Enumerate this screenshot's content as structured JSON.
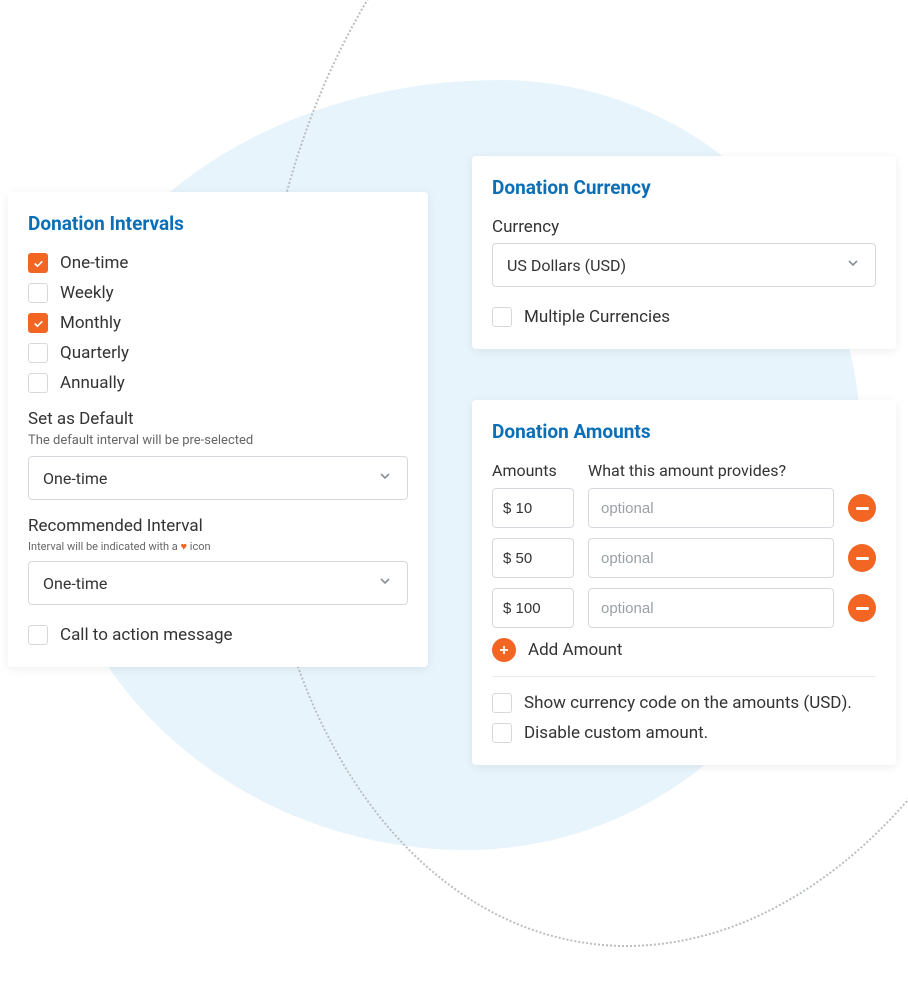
{
  "intervals": {
    "title": "Donation Intervals",
    "options": [
      {
        "label": "One-time",
        "checked": true
      },
      {
        "label": "Weekly",
        "checked": false
      },
      {
        "label": "Monthly",
        "checked": true
      },
      {
        "label": "Quarterly",
        "checked": false
      },
      {
        "label": "Annually",
        "checked": false
      }
    ],
    "default": {
      "label": "Set as Default",
      "help": "The default interval will be pre-selected",
      "value": "One-time"
    },
    "recommended": {
      "label": "Recommended Interval",
      "help_pre": "Interval will be indicated with a",
      "help_post": "icon",
      "value": "One-time"
    },
    "cta": {
      "label": "Call to action message",
      "checked": false
    }
  },
  "currency": {
    "title": "Donation Currency",
    "field_label": "Currency",
    "value": "US Dollars (USD)",
    "multiple": {
      "label": "Multiple Currencies",
      "checked": false
    }
  },
  "amounts": {
    "title": "Donation Amounts",
    "col_amounts": "Amounts",
    "col_provides": "What this amount provides?",
    "rows": [
      {
        "amount": "$ 10",
        "desc_placeholder": "optional"
      },
      {
        "amount": "$ 50",
        "desc_placeholder": "optional"
      },
      {
        "amount": "$ 100",
        "desc_placeholder": "optional"
      }
    ],
    "add_label": "Add Amount",
    "show_code": {
      "label": "Show currency code on the amounts (USD).",
      "checked": false
    },
    "disable_custom": {
      "label": "Disable custom amount.",
      "checked": false
    }
  },
  "colors": {
    "accent": "#f26522",
    "link": "#0a6fb7"
  }
}
